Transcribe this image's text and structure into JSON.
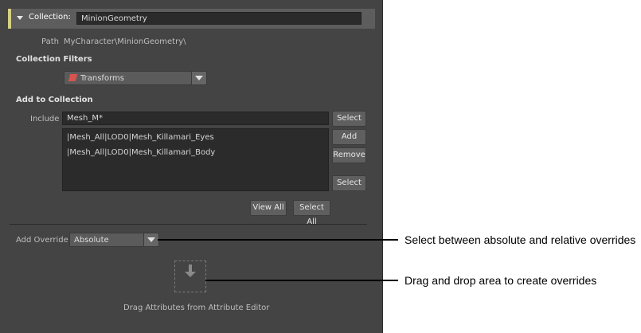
{
  "collection": {
    "label": "Collection:",
    "name": "MinionGeometry",
    "path_label": "Path",
    "path_value": "MyCharacter\\MinionGeometry\\"
  },
  "filters": {
    "heading": "Collection Filters",
    "selected": "Transforms",
    "icon": "transform-icon"
  },
  "add_to_collection": {
    "heading": "Add to Collection",
    "include_label": "Include",
    "include_value": "Mesh_M*",
    "members": [
      "|Mesh_All|LOD0|Mesh_Killamari_Eyes",
      "|Mesh_All|LOD0|Mesh_Killamari_Body"
    ],
    "buttons": {
      "select_top": "Select",
      "add": "Add",
      "remove": "Remove",
      "select_bottom": "Select",
      "view_all": "View All",
      "select_all": "Select All"
    }
  },
  "override": {
    "label": "Add Override",
    "selected": "Absolute",
    "drop_text": "Drag Attributes from Attribute Editor"
  },
  "annotations": {
    "override_note": "Select between absolute and relative overrides",
    "drop_note": "Drag and drop area to create overrides"
  },
  "colors": {
    "panel_bg": "#444444",
    "header_accent": "#d6d084",
    "field_bg": "#2b2b2b"
  }
}
